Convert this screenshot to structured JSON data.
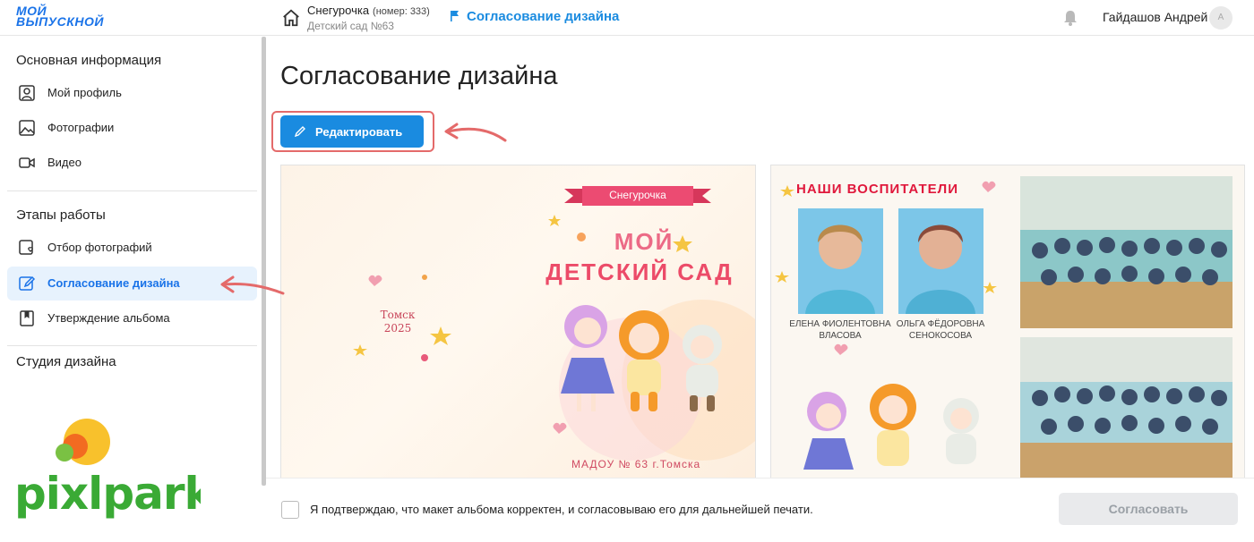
{
  "header": {
    "logo_line1": "МОЙ",
    "logo_line2": "ВЫПУСКНОЙ",
    "project_name": "Снегурочка",
    "project_number": "(номер: 333)",
    "project_sub": "Детский сад №63",
    "current_step": "Согласование дизайна",
    "user_name": "Гайдашов Андрей",
    "avatar_letter": "А"
  },
  "sidebar": {
    "section1": "Основная информация",
    "items1": [
      {
        "label": "Мой профиль",
        "icon": "profile-icon"
      },
      {
        "label": "Фотографии",
        "icon": "photo-icon"
      },
      {
        "label": "Видео",
        "icon": "video-icon"
      }
    ],
    "section2": "Этапы работы",
    "items2": [
      {
        "label": "Отбор фотографий",
        "icon": "photo-heart-icon"
      },
      {
        "label": "Согласование дизайна",
        "icon": "pencil-icon",
        "active": true
      },
      {
        "label": "Утверждение альбома",
        "icon": "bookmark-icon"
      }
    ],
    "section3": "Студия дизайна",
    "brand_logo": "pixlpark"
  },
  "main": {
    "title": "Согласование дизайна",
    "edit_button": "Редактировать",
    "left_spread": {
      "ribbon": "Снегурочка",
      "title_line1": "МОЙ",
      "title_line2": "ДЕТСКИЙ САД",
      "city_line1": "Томск",
      "city_line2": "2025",
      "footer": "МАДОУ № 63 г.Томска"
    },
    "right_spread": {
      "title": "НАШИ ВОСПИТАТЕЛИ",
      "teacher1_line1": "ЕЛЕНА ФИОЛЕНТОВНА",
      "teacher1_line2": "ВЛАСОВА",
      "teacher2_line1": "ОЛЬГА ФЁДОРОВНА",
      "teacher2_line2": "СЕНОКОСОВА"
    }
  },
  "footer": {
    "confirm_text": "Я подтверждаю, что макет альбома корректен, и согласовываю его для дальнейшей печати.",
    "agree_button": "Согласовать"
  },
  "colors": {
    "accent": "#1a8be0",
    "active_bg": "#e7f2fd",
    "highlight": "#e46a6a"
  }
}
